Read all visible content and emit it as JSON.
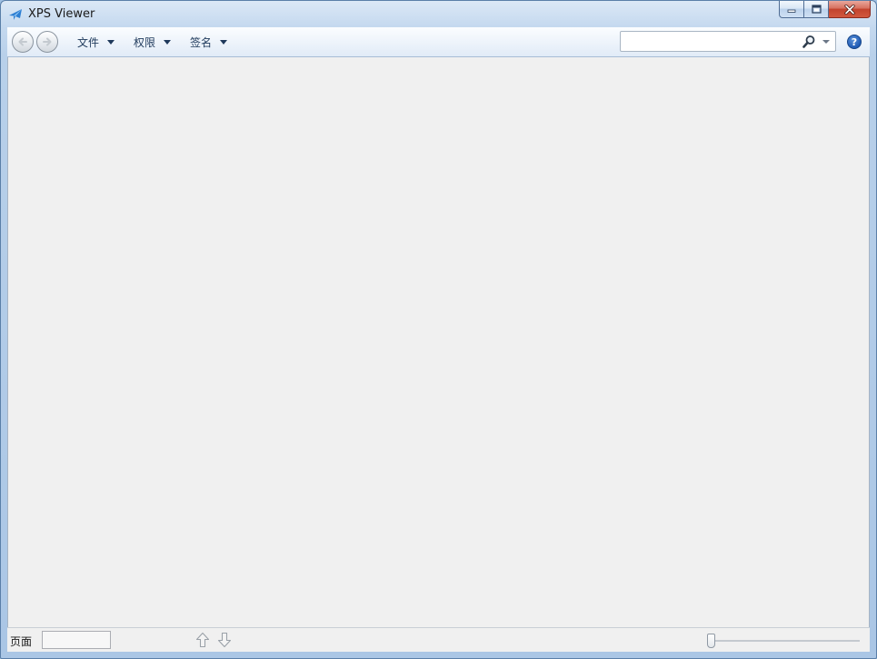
{
  "window": {
    "title": "XPS Viewer"
  },
  "titlebar": {
    "app_icon": "xps-viewer-icon",
    "minimize_icon": "minimize-icon",
    "maximize_icon": "restore-icon",
    "close_icon": "close-icon"
  },
  "toolbar": {
    "back_icon": "back-arrow-icon",
    "forward_icon": "forward-arrow-icon",
    "menus": [
      {
        "label": "文件"
      },
      {
        "label": "权限"
      },
      {
        "label": "签名"
      }
    ],
    "search": {
      "value": "",
      "placeholder": "",
      "icon": "search-icon"
    },
    "help_label": "?"
  },
  "statusbar": {
    "page_label": "页面",
    "page_value": "",
    "prev_icon": "arrow-up-icon",
    "next_icon": "arrow-down-icon",
    "zoom_level": 0
  },
  "colors": {
    "content_bg": "#f0f0f0",
    "frame": "#aac6e5",
    "close_button": "#c2432e",
    "help_button": "#1f5bb5"
  }
}
